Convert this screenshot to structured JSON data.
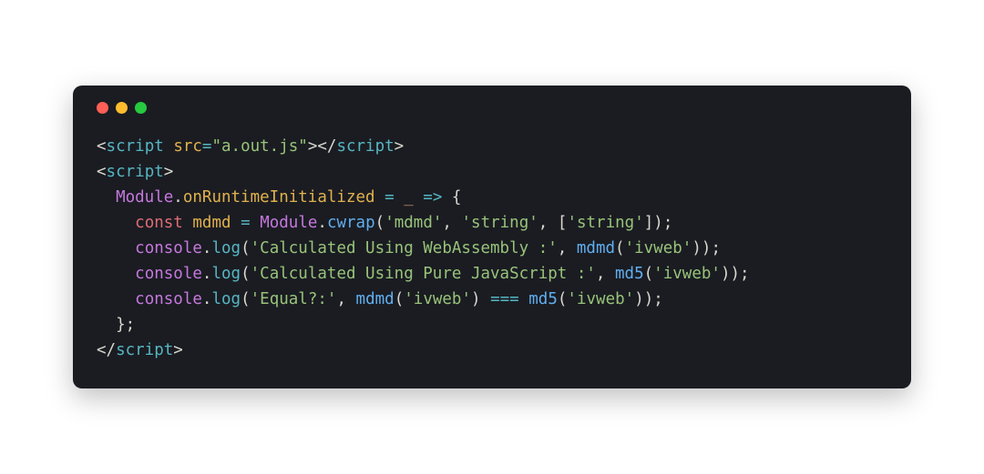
{
  "window": {
    "traffic_lights": {
      "close": "close",
      "minimize": "minimize",
      "zoom": "zoom"
    }
  },
  "code": {
    "lines": [
      {
        "t0": "<",
        "t1": "script",
        "t2": " ",
        "t3": "src",
        "t4": "=",
        "t5": "\"a.out.js\"",
        "t6": ">",
        "t7": "</",
        "t8": "script",
        "t9": ">"
      },
      {
        "t0": "<",
        "t1": "script",
        "t2": ">"
      },
      {
        "indent": "  ",
        "t0": "Module",
        "t1": ".",
        "t2": "onRuntimeInitialized",
        "t3": " ",
        "t4": "=",
        "t5": " ",
        "t6": "_",
        "t7": " ",
        "t8": "=>",
        "t9": " ",
        "t10": "{"
      },
      {
        "indent": "    ",
        "t0": "const",
        "t1": " ",
        "t2": "mdmd",
        "t3": " ",
        "t4": "=",
        "t5": " ",
        "t6": "Module",
        "t7": ".",
        "t8": "cwrap",
        "t9": "(",
        "t10": "'mdmd'",
        "t11": ",",
        "t12": " ",
        "t13": "'string'",
        "t14": ",",
        "t15": " ",
        "t16": "[",
        "t17": "'string'",
        "t18": "]",
        "t19": ")",
        "t20": ";"
      },
      {
        "indent": "    ",
        "t0": "console",
        "t1": ".",
        "t2": "log",
        "t3": "(",
        "t4": "'Calculated Using WebAssembly :'",
        "t5": ",",
        "t6": " ",
        "t7": "mdmd",
        "t8": "(",
        "t9": "'ivweb'",
        "t10": ")",
        "t11": ")",
        "t12": ";"
      },
      {
        "indent": "    ",
        "t0": "console",
        "t1": ".",
        "t2": "log",
        "t3": "(",
        "t4": "'Calculated Using Pure JavaScript :'",
        "t5": ",",
        "t6": " ",
        "t7": "md5",
        "t8": "(",
        "t9": "'ivweb'",
        "t10": ")",
        "t11": ")",
        "t12": ";"
      },
      {
        "indent": "    ",
        "t0": "console",
        "t1": ".",
        "t2": "log",
        "t3": "(",
        "t4": "'Equal?:'",
        "t5": ",",
        "t6": " ",
        "t7": "mdmd",
        "t8": "(",
        "t9": "'ivweb'",
        "t10": ")",
        "t11": " ",
        "t12": "===",
        "t13": " ",
        "t14": "md5",
        "t15": "(",
        "t16": "'ivweb'",
        "t17": ")",
        "t18": ")",
        "t19": ";"
      },
      {
        "indent": "  ",
        "t0": "}",
        "t1": ";"
      },
      {
        "t0": "</",
        "t1": "script",
        "t2": ">"
      }
    ]
  }
}
